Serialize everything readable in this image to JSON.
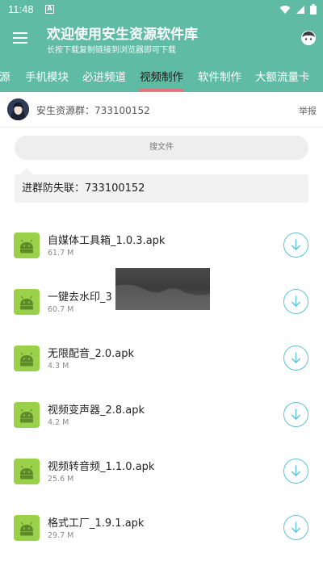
{
  "status": {
    "time": "11:48",
    "notification_icon": "a-icon"
  },
  "appbar": {
    "title": "欢迎使用安生资源软件库",
    "subtitle": "长按下载复制链接到浏览器即可下载"
  },
  "tabs": [
    {
      "label": "源",
      "active": false
    },
    {
      "label": "手机模块",
      "active": false
    },
    {
      "label": "必进频道",
      "active": false
    },
    {
      "label": "视频制作",
      "active": true
    },
    {
      "label": "软件制作",
      "active": false
    },
    {
      "label": "大额流量卡",
      "active": false
    }
  ],
  "group": {
    "text": "安生资源群：733100152",
    "report": "举报"
  },
  "search": {
    "placeholder": "搜文件"
  },
  "notice": {
    "text": "进群防失联：733100152"
  },
  "files": [
    {
      "name": "自媒体工具箱_1.0.3.apk",
      "size": "61.7 M"
    },
    {
      "name": "一键去水印_3",
      "size": "60.7 M"
    },
    {
      "name": "无限配音_2.0.apk",
      "size": "4.3 M"
    },
    {
      "name": "视频变声器_2.8.apk",
      "size": "4.2 M"
    },
    {
      "name": "视频转音频_1.1.0.apk",
      "size": "25.6 M"
    },
    {
      "name": "格式工厂_1.9.1.apk",
      "size": "29.7 M"
    }
  ],
  "colors": {
    "primary": "#5fbba3",
    "indicator": "#e57373",
    "download": "#5ec2d9",
    "apk": "#9bd14a"
  }
}
